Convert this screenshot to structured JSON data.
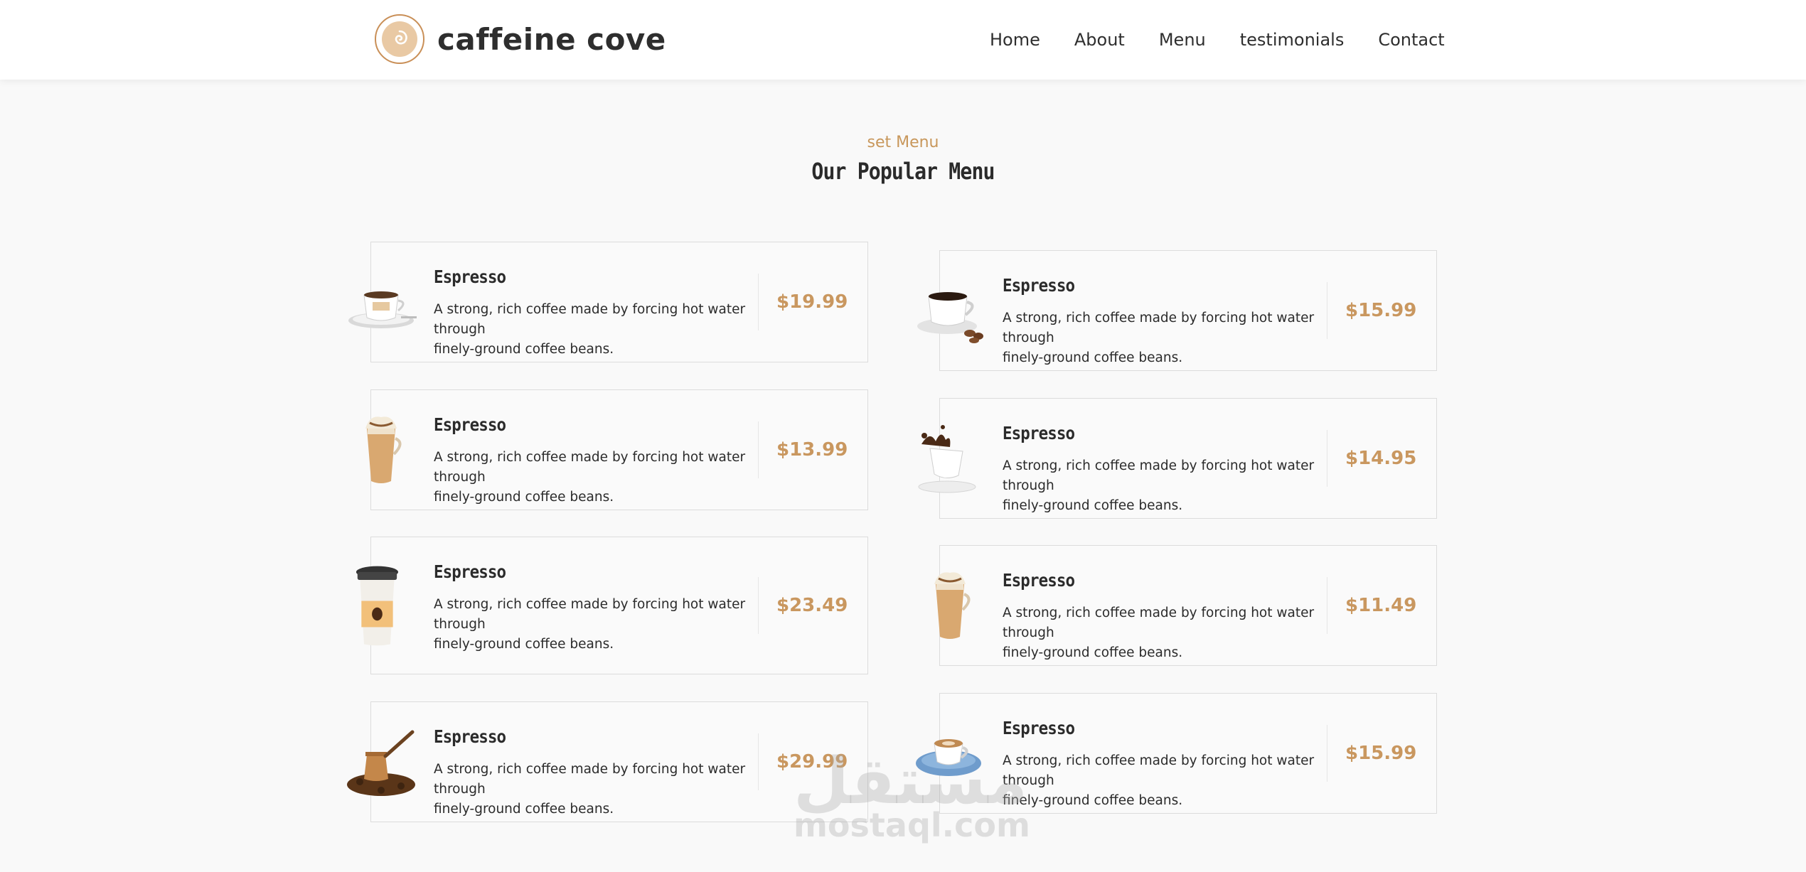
{
  "header": {
    "brand": "caffeine cove",
    "nav": [
      "Home",
      "About",
      "Menu",
      "testimonials",
      "Contact"
    ]
  },
  "section": {
    "eyebrow": "set Menu",
    "title": "Our Popular Menu"
  },
  "items": [
    {
      "name": "Espresso",
      "desc_line1": "A strong, rich coffee made by forcing hot water through",
      "desc_line2": "finely-ground coffee beans.",
      "price": "$19.99",
      "image": "espresso-cup-icon"
    },
    {
      "name": "Espresso",
      "desc_line1": "A strong, rich coffee made by forcing hot water through",
      "desc_line2": "finely-ground coffee beans.",
      "price": "$15.99",
      "image": "coffee-cup-beans-icon"
    },
    {
      "name": "Espresso",
      "desc_line1": "A strong, rich coffee made by forcing hot water through",
      "desc_line2": "finely-ground coffee beans.",
      "price": "$13.99",
      "image": "frappe-icon"
    },
    {
      "name": "Espresso",
      "desc_line1": "A strong, rich coffee made by forcing hot water through",
      "desc_line2": "finely-ground coffee beans.",
      "price": "$14.95",
      "image": "splash-cup-icon"
    },
    {
      "name": "Espresso",
      "desc_line1": "A strong, rich coffee made by forcing hot water through",
      "desc_line2": "finely-ground coffee beans.",
      "price": "$23.49",
      "image": "takeaway-cup-icon"
    },
    {
      "name": "Espresso",
      "desc_line1": "A strong, rich coffee made by forcing hot water through",
      "desc_line2": "finely-ground coffee beans.",
      "price": "$11.49",
      "image": "frappe-icon"
    },
    {
      "name": "Espresso",
      "desc_line1": "A strong, rich coffee made by forcing hot water through",
      "desc_line2": "finely-ground coffee beans.",
      "price": "$29.99",
      "image": "turkish-pot-icon"
    },
    {
      "name": "Espresso",
      "desc_line1": "A strong, rich coffee made by forcing hot water through",
      "desc_line2": "finely-ground coffee beans.",
      "price": "$15.99",
      "image": "cappuccino-cup-icon"
    }
  ],
  "watermark": {
    "arabic": "مستقل",
    "latin": "mostaql.com"
  },
  "colors": {
    "accent": "#c9975f",
    "text": "#2b2b2b",
    "background": "#f9f9f9"
  }
}
